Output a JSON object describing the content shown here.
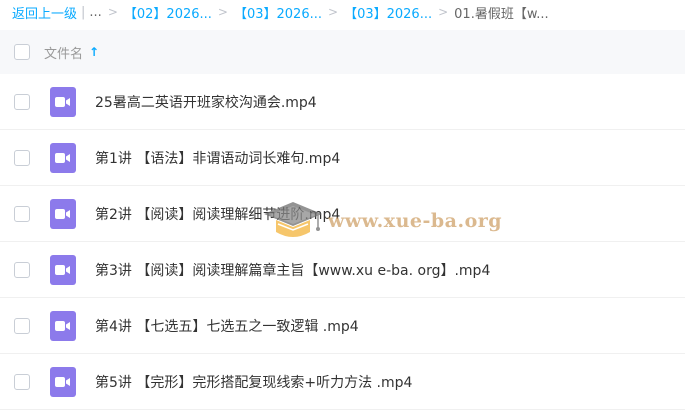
{
  "breadcrumb": {
    "back_label": "返回上一级",
    "ellipsis": "...",
    "items": [
      "【02】2026...",
      "【03】2026...",
      "【03】2026..."
    ],
    "current": "01.暑假班【w..."
  },
  "header": {
    "name_label": "文件名",
    "sort_indicator": "↑"
  },
  "files": [
    {
      "name": "25暑高二英语开班家校沟通会.mp4",
      "icon": "video-file-icon"
    },
    {
      "name": "第1讲 【语法】非谓语动词长难句.mp4",
      "icon": "video-file-icon"
    },
    {
      "name": "第2讲 【阅读】阅读理解细节进阶.mp4",
      "icon": "video-file-icon"
    },
    {
      "name": "第3讲 【阅读】阅读理解篇章主旨【www.xu e-ba. org】.mp4",
      "icon": "video-file-icon"
    },
    {
      "name": "第4讲 【七选五】七选五之一致逻辑 .mp4",
      "icon": "video-file-icon"
    },
    {
      "name": "第5讲 【完形】完形搭配复现线索+听力方法 .mp4",
      "icon": "video-file-icon"
    }
  ],
  "watermark": {
    "text": "www.xue-ba.org"
  },
  "colors": {
    "accent": "#09aaff",
    "video_icon": "#8c7aeb",
    "header_bg": "#f7f8fa"
  }
}
